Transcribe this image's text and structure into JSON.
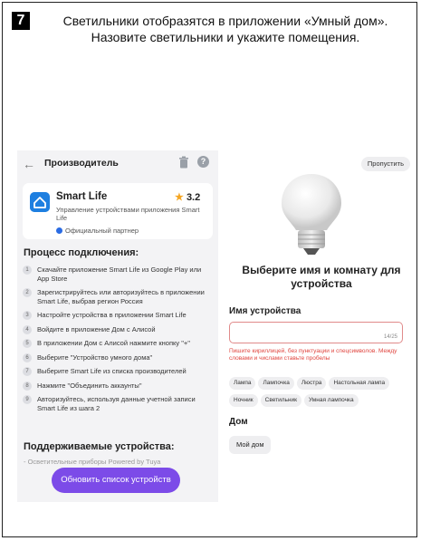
{
  "header": {
    "step_number": "7",
    "instruction_line1": "Светильники отобразятся в приложении «Умный дом».",
    "instruction_line2": "Назовите светильники и укажите помещения."
  },
  "left_screen": {
    "back_icon": "arrow-left-icon",
    "title": "Производитель",
    "trash_icon": "trash-icon",
    "help_icon": "question-icon",
    "help_glyph": "?",
    "app": {
      "name": "Smart Life",
      "rating": "3.2",
      "description": "Управление устройствами приложения Smart Life",
      "partner_label": "Официальный партнер"
    },
    "process_title": "Процесс подключения:",
    "steps": [
      {
        "num": "1",
        "text": "Скачайте приложение Smart Life из Google Play или App Store"
      },
      {
        "num": "2",
        "text": "Зарегистрируйтесь или авторизуйтесь в приложении Smart Life, выбрав регион Россия"
      },
      {
        "num": "3",
        "text": "Настройте устройства в приложении Smart Life"
      },
      {
        "num": "4",
        "text": "Войдите в приложение Дом с Алисой"
      },
      {
        "num": "5",
        "text": "В приложении Дом с Алисой нажмите кнопку \"+\""
      },
      {
        "num": "6",
        "text": "Выберите \"Устройство умного дома\""
      },
      {
        "num": "7",
        "text": "Выберите Smart Life из списка производителей"
      },
      {
        "num": "8",
        "text": "Нажмите \"Объединить аккаунты\""
      },
      {
        "num": "9",
        "text": "Авторизуйтесь, используя данные учетной записи Smart Life из шага 2"
      }
    ],
    "supported_title": "Поддерживаемые устройства:",
    "supported_item": "- Осветительные приборы Powered by Tuya",
    "update_button": "Обновить список устройств",
    "accent_color": "#7c4be8"
  },
  "right_screen": {
    "skip_button": "Пропустить",
    "bulb_icon": "light-bulb-icon",
    "title": "Выберите имя и комнату для устройства",
    "name_label": "Имя устройства",
    "name_value": "",
    "counter": "14/25",
    "error_text": "Пишите кириллицей, без пунктуации и спецсимволов. Между словами и числами ставьте пробелы",
    "chips_row1": [
      "Лампа",
      "Лампочка",
      "Люстра",
      "Настольная лампа"
    ],
    "chips_row2": [
      "Ночник",
      "Светильник",
      "Умная лампочка"
    ],
    "home_label": "Дом",
    "home_value": "Мой дом",
    "error_color": "#e0453f"
  }
}
